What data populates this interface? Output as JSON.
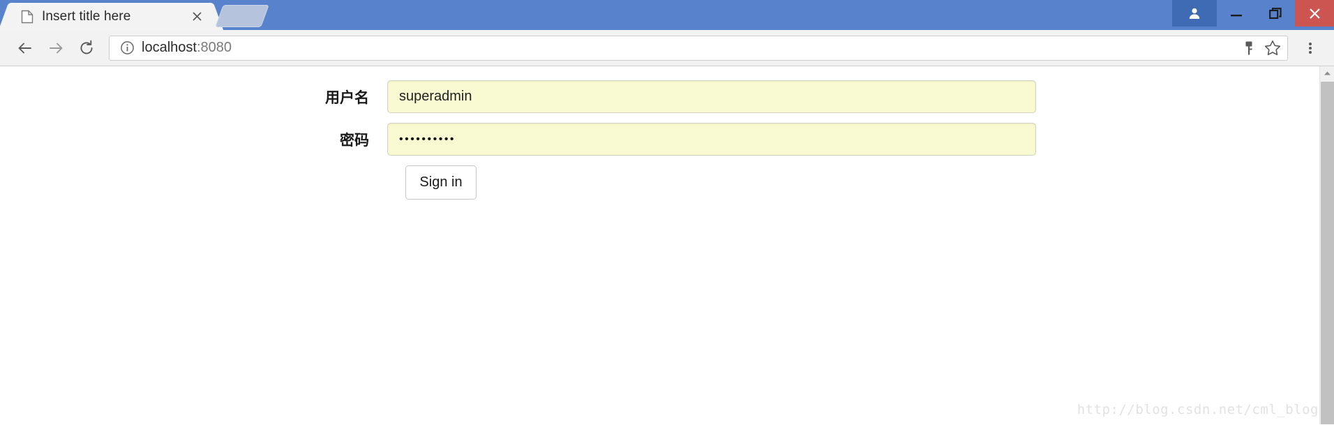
{
  "browser": {
    "tab": {
      "title": "Insert title here",
      "favicon_icon": "page-icon",
      "close_icon": "close-icon"
    },
    "new_tab_icon": "new-tab-button",
    "window_controls": {
      "avatar_icon": "user-avatar-icon",
      "minimize_icon": "minimize-icon",
      "maximize_icon": "restore-icon",
      "close_icon": "window-close-icon"
    },
    "toolbar": {
      "back_icon": "back-arrow-icon",
      "forward_icon": "forward-arrow-icon",
      "reload_icon": "reload-icon",
      "info_icon": "info-circle-icon",
      "url_host": "localhost",
      "url_port": ":8080",
      "save_password_icon": "key-icon",
      "bookmark_icon": "star-icon",
      "menu_icon": "three-dot-menu-icon"
    },
    "colors": {
      "titlebar_blue": "#5882cc",
      "avatar_blue": "#3f6ab4",
      "close_red": "#cc5552",
      "toolbar_gray": "#f2f2f2",
      "tab_gray": "#f3f3f3",
      "newtab_blue_gray": "#b5c3dc",
      "autofill_yellow": "#fafad2",
      "scrollbar_thumb": "#c1c1c1"
    }
  },
  "page": {
    "form": {
      "username": {
        "label": "用户名",
        "value": "superadmin",
        "placeholder": ""
      },
      "password": {
        "label": "密码",
        "value": "••••••••••",
        "placeholder": ""
      },
      "submit_label": "Sign in"
    },
    "watermark": "http://blog.csdn.net/cml_blog"
  }
}
